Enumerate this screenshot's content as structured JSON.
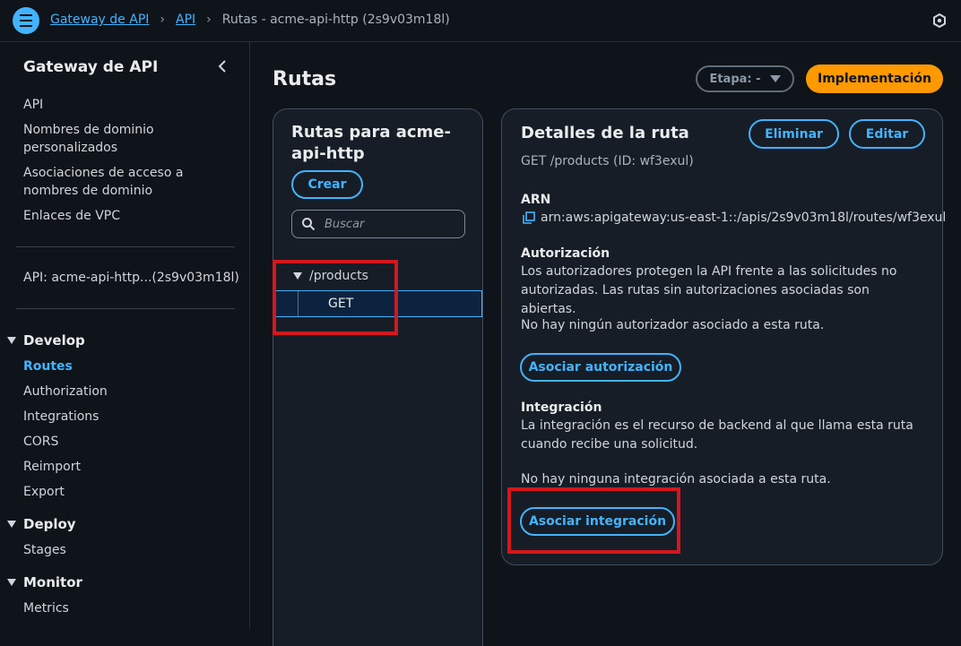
{
  "breadcrumb": {
    "items": [
      "Gateway de API",
      "API"
    ],
    "current": "Rutas - acme-api-http (2s9v03m18l)"
  },
  "sidebar": {
    "title": "Gateway de API",
    "links": [
      "API",
      "Nombres de dominio personalizados",
      "Asociaciones de acceso a nombres de dominio",
      "Enlaces de VPC"
    ],
    "api_label": "API: acme-api-http...(2s9v03m18l)",
    "sections": [
      {
        "label": "Develop",
        "items": [
          "Routes",
          "Authorization",
          "Integrations",
          "CORS",
          "Reimport",
          "Export"
        ]
      },
      {
        "label": "Deploy",
        "items": [
          "Stages"
        ]
      },
      {
        "label": "Monitor",
        "items": [
          "Metrics"
        ]
      }
    ],
    "active_item": "Routes"
  },
  "header": {
    "title": "Rutas",
    "stage_select": "Etapa: -",
    "deploy_button": "Implementación"
  },
  "routes_panel": {
    "title": "Rutas para acme-api-http",
    "create_button": "Crear",
    "search_placeholder": "Buscar",
    "tree": {
      "path": "/products",
      "method": "GET"
    }
  },
  "details_panel": {
    "title": "Detalles de la ruta",
    "delete_button": "Eliminar",
    "edit_button": "Editar",
    "subtitle": "GET /products (ID: wf3exul)",
    "arn_label": "ARN",
    "arn_value": "arn:aws:apigateway:us-east-1::/apis/2s9v03m18l/routes/wf3exul",
    "authorization_label": "Autorización",
    "authorization_desc": "Los autorizadores protegen la API frente a las solicitudes no autorizadas. Las rutas sin autorizaciones asociadas son abiertas.",
    "authorization_empty": "No hay ningún autorizador asociado a esta ruta.",
    "attach_authorization_button": "Asociar autorización",
    "integration_label": "Integración",
    "integration_desc": "La integración es el recurso de backend al que llama esta ruta cuando recibe una solicitud.",
    "integration_empty": "No hay ninguna integración asociada a esta ruta.",
    "attach_integration_button": "Asociar integración"
  },
  "colors": {
    "background": "#0f141a",
    "accent": "#42b4ff",
    "primary_button": "#ff9900",
    "highlight": "#d4171d"
  }
}
